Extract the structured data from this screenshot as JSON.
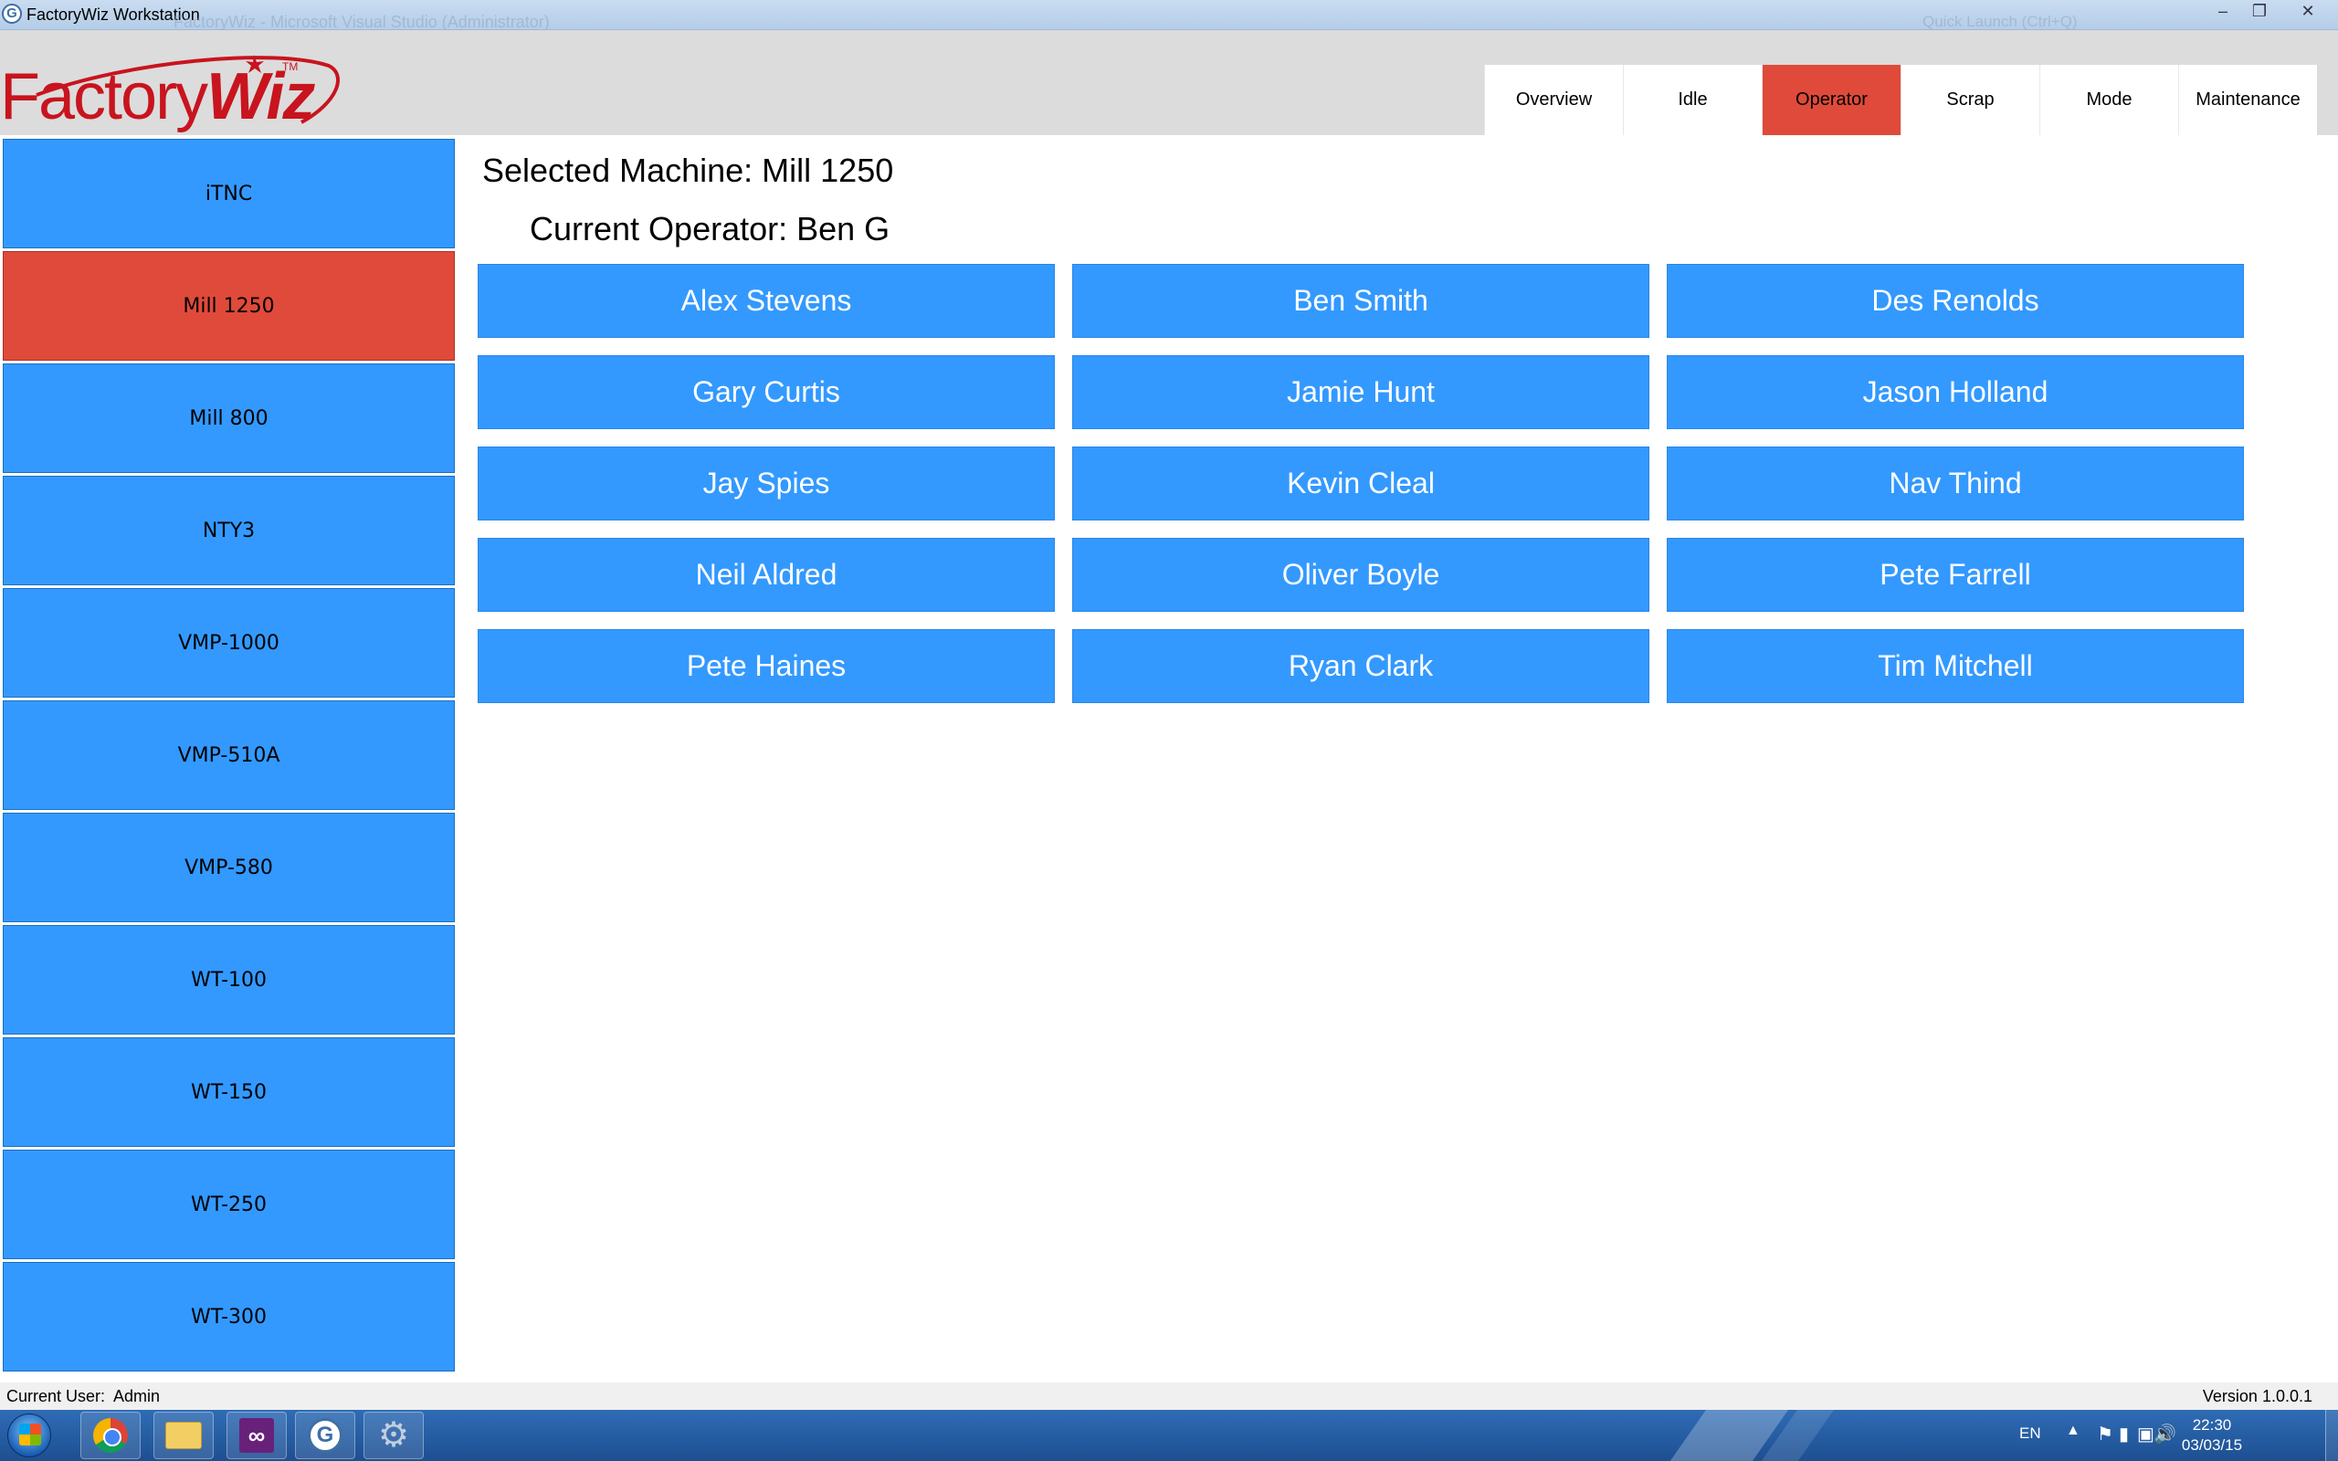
{
  "window": {
    "title": "FactoryWiz Workstation",
    "app_icon": "G",
    "background_title": "FactoryWiz - Microsoft Visual Studio (Administrator)",
    "background_quick_launch": "Quick Launch (Ctrl+Q)"
  },
  "logo": {
    "text_a": "Factory",
    "text_b": "Wiz",
    "tm": "TM"
  },
  "tabs": [
    {
      "label": "Overview"
    },
    {
      "label": "Idle"
    },
    {
      "label": "Operator",
      "active": true
    },
    {
      "label": "Scrap"
    },
    {
      "label": "Mode"
    },
    {
      "label": "Maintenance"
    }
  ],
  "machines": [
    {
      "label": "iTNC"
    },
    {
      "label": "Mill 1250",
      "selected": true
    },
    {
      "label": "Mill 800"
    },
    {
      "label": "NTY3"
    },
    {
      "label": "VMP-1000"
    },
    {
      "label": "VMP-510A"
    },
    {
      "label": "VMP-580"
    },
    {
      "label": "WT-100"
    },
    {
      "label": "WT-150"
    },
    {
      "label": "WT-250"
    },
    {
      "label": "WT-300"
    }
  ],
  "main": {
    "selected_machine": "Selected Machine: Mill 1250",
    "current_operator": "Current Operator: Ben G"
  },
  "operators": [
    "Alex Stevens",
    "Ben Smith",
    "Des Renolds",
    "Gary Curtis",
    "Jamie Hunt",
    "Jason Holland",
    "Jay Spies",
    "Kevin Cleal",
    "Nav Thind",
    "Neil Aldred",
    "Oliver Boyle",
    "Pete Farrell",
    "Pete Haines",
    "Ryan Clark",
    "Tim Mitchell"
  ],
  "status": {
    "current_user": "Current User:  Admin",
    "version": "Version 1.0.0.1"
  },
  "taskbar": {
    "language": "EN",
    "time": "22:30",
    "date": "03/03/15",
    "apps": [
      "chrome-icon",
      "folder-icon",
      "visual-studio-icon",
      "factorywiz-icon",
      "settings-gear-icon"
    ]
  },
  "colors": {
    "accent_blue": "#3399ff",
    "active_red": "#e04a3a",
    "logo_red": "#c8141e",
    "header_gray": "#dcdcdc"
  }
}
